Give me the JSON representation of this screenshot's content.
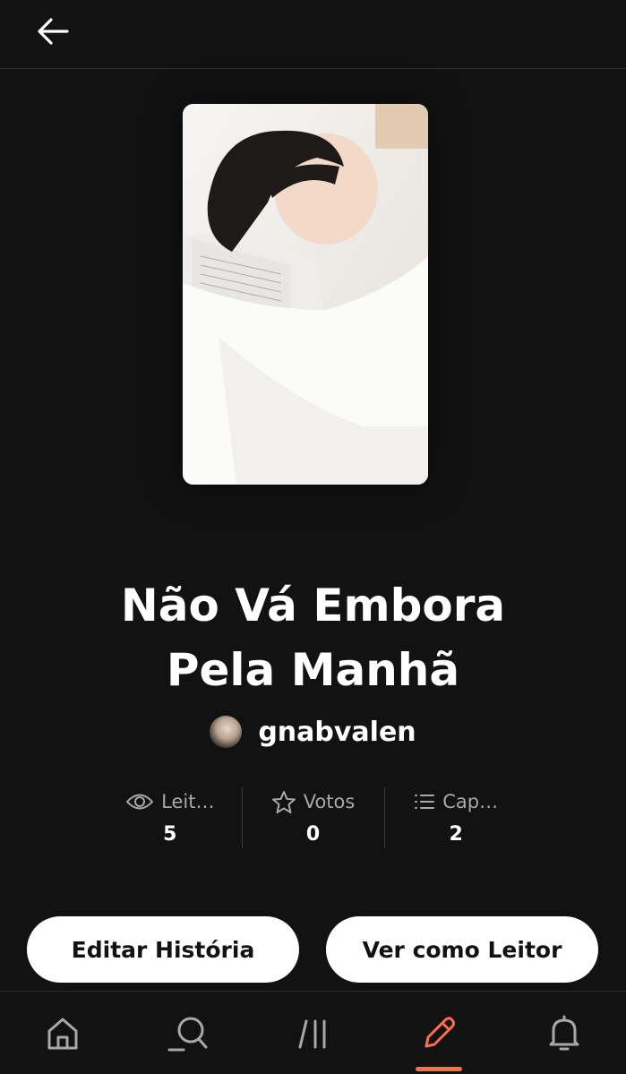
{
  "header": {
    "back_icon": "arrow-left-icon"
  },
  "story": {
    "title_line1": "Não Vá Embora",
    "title_line2": "Pela Manhã",
    "author": "gnabvalen"
  },
  "stats": {
    "reads_label": "Leit…",
    "reads_value": "5",
    "reads_icon": "eye-icon",
    "votes_label": "Votos",
    "votes_value": "0",
    "votes_icon": "star-icon",
    "chapters_label": "Cap…",
    "chapters_value": "2",
    "chapters_icon": "list-icon"
  },
  "actions": {
    "edit_label": "Editar História",
    "reader_label": "Ver como Leitor"
  },
  "nav": {
    "items": [
      "home-icon",
      "search-icon",
      "library-icon",
      "write-icon",
      "bell-icon"
    ],
    "active": "write-icon"
  },
  "colors": {
    "background": "#121212",
    "accent": "#ff6e4a",
    "muted_text": "#a8a8a8"
  }
}
